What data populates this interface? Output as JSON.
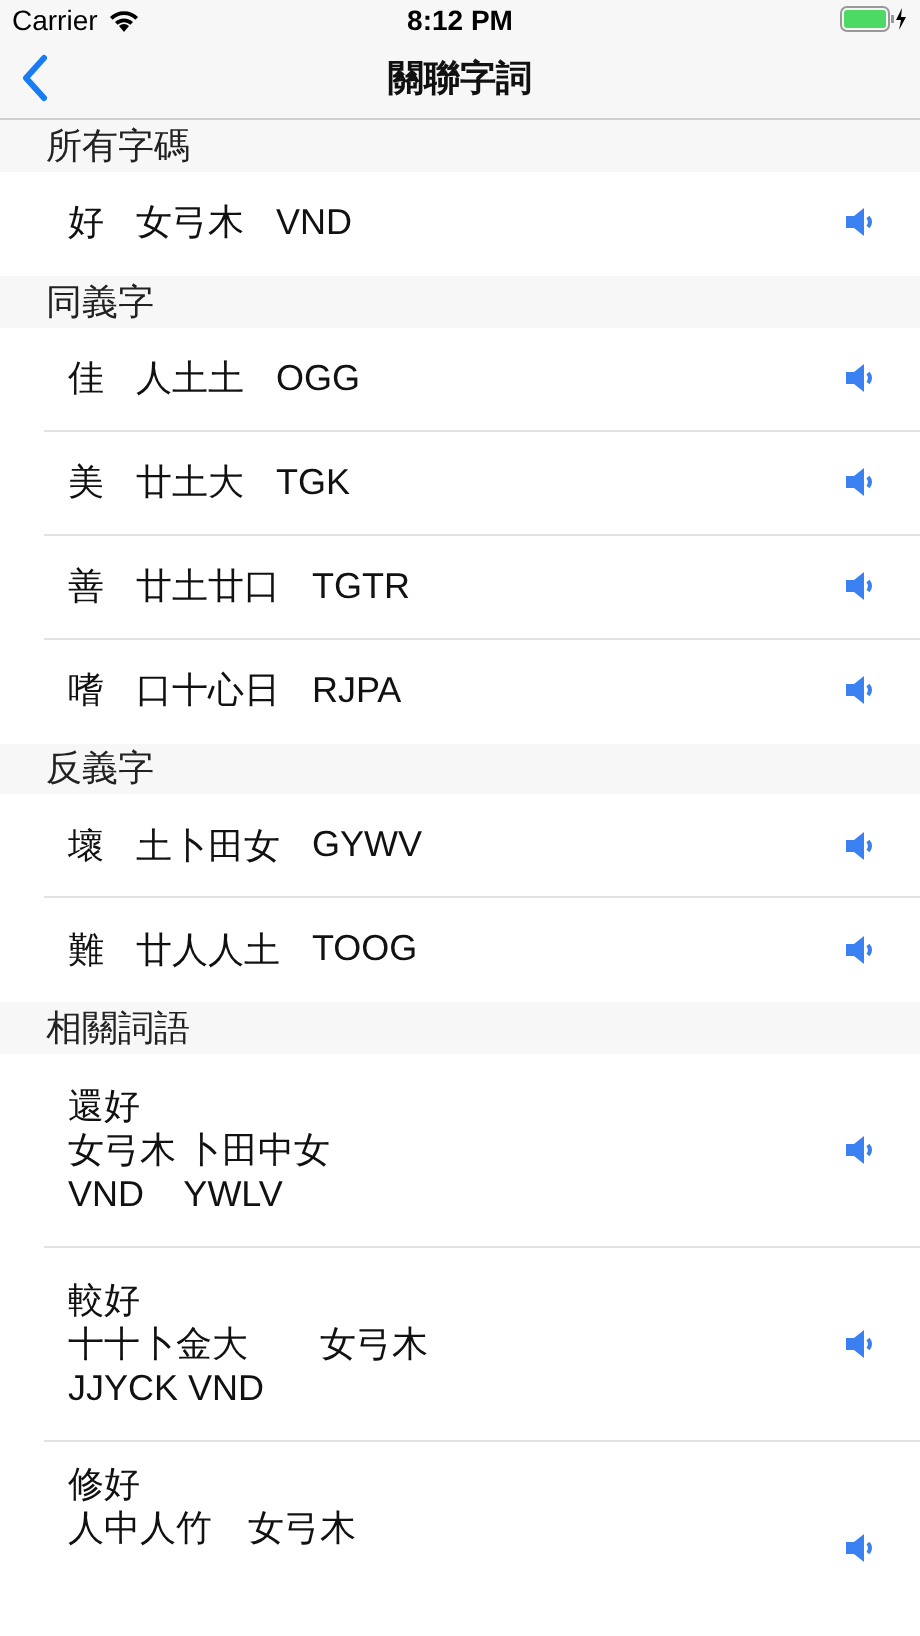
{
  "status_bar": {
    "carrier": "Carrier",
    "time": "8:12 PM"
  },
  "nav": {
    "title": "關聯字詞"
  },
  "sections": [
    {
      "title": "所有字碼",
      "rows": [
        {
          "kind": "single",
          "parts": [
            "好",
            "女弓木",
            "VND"
          ]
        }
      ]
    },
    {
      "title": "同義字",
      "rows": [
        {
          "kind": "single",
          "parts": [
            "佳",
            "人土土",
            "OGG"
          ]
        },
        {
          "kind": "single",
          "parts": [
            "美",
            "廿土大",
            "TGK"
          ]
        },
        {
          "kind": "single",
          "parts": [
            "善",
            "廿土廿口",
            "TGTR"
          ]
        },
        {
          "kind": "single",
          "parts": [
            "嗜",
            "口十心日",
            "RJPA"
          ]
        }
      ]
    },
    {
      "title": "反義字",
      "rows": [
        {
          "kind": "single",
          "parts": [
            "壞",
            "土卜田女",
            "GYWV"
          ]
        },
        {
          "kind": "single",
          "parts": [
            "難",
            "廿人人土",
            "TOOG"
          ]
        }
      ]
    },
    {
      "title": "相關詞語",
      "rows": [
        {
          "kind": "multi",
          "parts": [
            "還好",
            "女弓木 卜田中女",
            "VND    YWLV"
          ]
        },
        {
          "kind": "multi",
          "parts": [
            "較好",
            "十十卜金大　　女弓木",
            "JJYCK VND"
          ]
        },
        {
          "kind": "multi",
          "parts": [
            "修好",
            "人中人竹　女弓木"
          ]
        }
      ]
    }
  ]
}
